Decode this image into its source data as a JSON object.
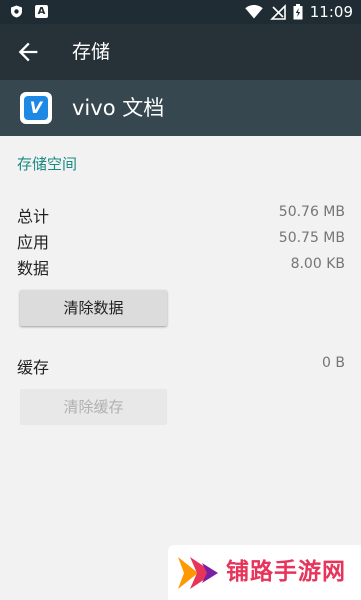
{
  "status_bar": {
    "time": "11:09",
    "left_icons": [
      "shield-notification-icon",
      "a-notification-icon"
    ],
    "right_icons": [
      "wifi-icon",
      "no-sim-icon",
      "battery-charging-icon"
    ]
  },
  "app_bar": {
    "back_icon": "arrow-left-icon",
    "title": "存储"
  },
  "app_header": {
    "icon_letter": "V",
    "name": "vivo 文档"
  },
  "section_title": "存储空间",
  "storage_rows": [
    {
      "label": "总计",
      "value": "50.76 MB"
    },
    {
      "label": "应用",
      "value": "50.75 MB"
    },
    {
      "label": "数据",
      "value": "8.00 KB"
    }
  ],
  "clear_data_label": "清除数据",
  "cache": {
    "label": "缓存",
    "value": "0 B"
  },
  "clear_cache_label": "清除缓存",
  "watermark": {
    "text": "铺路手游网"
  },
  "colors": {
    "status_bar": "#1f2c33",
    "app_bar": "#263238",
    "app_header": "#37474f",
    "accent": "#1a8a83",
    "watermark": "#e8335a"
  }
}
